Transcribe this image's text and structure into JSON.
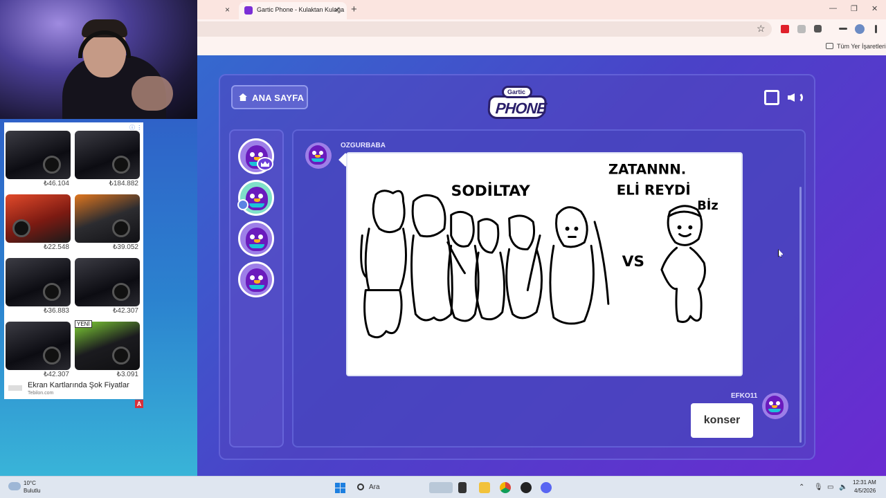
{
  "browser": {
    "tab_title": "Gartic Phone - Kulaktan Kulağa",
    "bookmarks_label": "Tüm Yer İşaretleri",
    "tab_close_glyph": "×",
    "new_tab_glyph": "+"
  },
  "game": {
    "home_label": "ANA SAYFA",
    "logo_top": "Gartic",
    "logo_main": "PHONE",
    "drawing_author": "OZGURBABA",
    "answer_author": "EFKO11",
    "answer_text": "konser",
    "player_count": 4
  },
  "drawing_text": {
    "top_right_line1": "ZATANNN.",
    "top_right_line2": "ELİ REYDİ",
    "top_right_line3": "Bİz",
    "top_center": "SODİLTAY",
    "vs": "VS"
  },
  "ad": {
    "items": [
      {
        "price": "₺46.104",
        "style": "dark"
      },
      {
        "price": "₺184.882",
        "style": "dark"
      },
      {
        "price": "₺22.548",
        "style": "red"
      },
      {
        "price": "₺39.052",
        "style": "orange"
      },
      {
        "price": "₺36.883",
        "style": "dark"
      },
      {
        "price": "₺42.307",
        "style": "dark"
      },
      {
        "price": "₺42.307",
        "style": "dark"
      },
      {
        "price": "₺3.091",
        "style": "green"
      }
    ],
    "new_badge": "YENİ",
    "headline": "Ekran Kartlarında Şok Fiyatlar",
    "domain": "Tebilon.com",
    "badge": "A"
  },
  "taskbar": {
    "weather_temp": "10°C",
    "weather_desc": "Bulutlu",
    "search_label": "Ara",
    "time": "12:31 AM",
    "date": "4/5/2026"
  },
  "colors": {
    "accent_purple": "#6a1bbd",
    "answer_bubble": "#ffffff"
  }
}
